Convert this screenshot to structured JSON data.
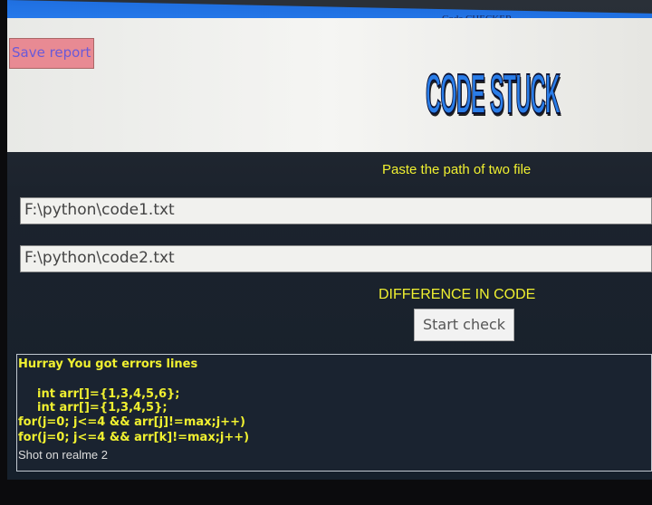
{
  "window": {
    "title": "Code CHECKER"
  },
  "toolbar": {
    "save_label": "Save report"
  },
  "logo": {
    "text": "CODE STUCK"
  },
  "main": {
    "instruction": "Paste the path of two file",
    "file1": "F:\\python\\code1.txt",
    "file2": "F:\\python\\code2.txt",
    "diff_heading": "DIFFERENCE IN CODE",
    "start_label": "Start check"
  },
  "output": {
    "heading": "Hurray You got errors lines",
    "lines": [
      "int arr[]={1,3,4,5,6};",
      "int arr[]={1,3,4,5};",
      "for(j=0; j<=4 && arr[j]!=max;j++)",
      "for(j=0; j<=4 && arr[k]!=max;j++)"
    ]
  },
  "watermark": "Shot on realme 2",
  "colors": {
    "titlebar": "#2a7ff0",
    "save_button": "#e88a93",
    "accent_text": "#f0f030"
  }
}
